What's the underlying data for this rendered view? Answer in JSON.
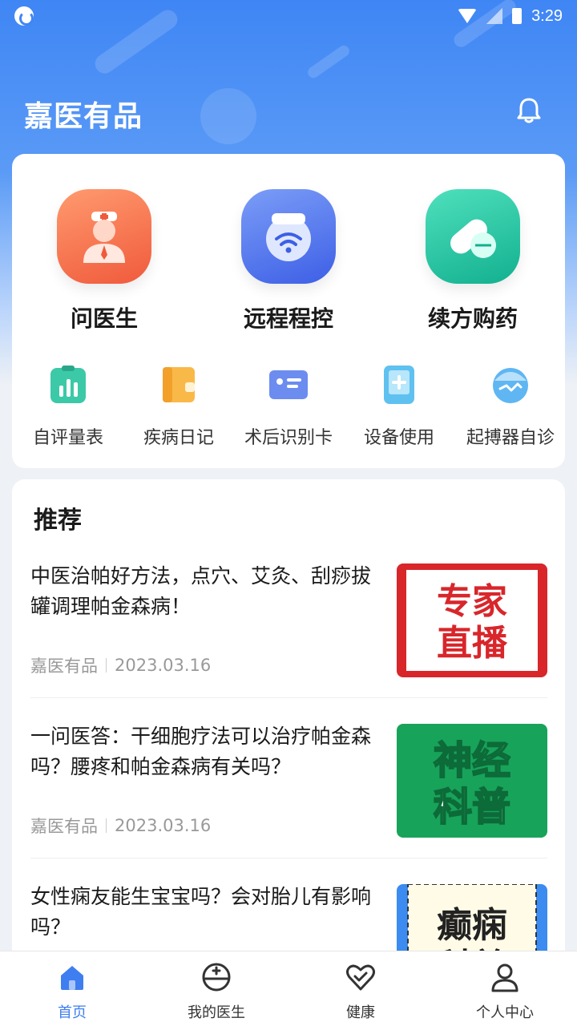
{
  "status_bar": {
    "time": "3:29"
  },
  "header": {
    "app_title": "嘉医有品"
  },
  "quick_actions": [
    {
      "label": "问医生",
      "icon": "doctor-icon",
      "color": "#f46a4a"
    },
    {
      "label": "远程程控",
      "icon": "remote-control-icon",
      "color": "#4a72f0"
    },
    {
      "label": "续方购药",
      "icon": "pill-icon",
      "color": "#22c3a6"
    }
  ],
  "tools": [
    {
      "label": "自评量表",
      "icon": "scale-chart-icon"
    },
    {
      "label": "疾病日记",
      "icon": "diary-icon"
    },
    {
      "label": "术后识别卡",
      "icon": "id-card-icon"
    },
    {
      "label": "设备使用",
      "icon": "device-icon"
    },
    {
      "label": "起搏器自诊",
      "icon": "pacemaker-icon"
    }
  ],
  "recommend": {
    "title": "推荐",
    "articles": [
      {
        "title": "中医治帕好方法，点穴、艾灸、刮痧拔罐调理帕金森病！",
        "source": "嘉医有品",
        "date": "2023.03.16",
        "thumb_text": [
          "专家",
          "直播"
        ],
        "thumb_color": "#d8262b"
      },
      {
        "title": "一问医答：干细胞疗法可以治疗帕金森吗？腰疼和帕金森病有关吗？",
        "source": "嘉医有品",
        "date": "2023.03.16",
        "thumb_text": [
          "神经",
          "科普"
        ],
        "thumb_color": "#18a35a"
      },
      {
        "title": "女性痫友能生宝宝吗？会对胎儿有影响吗？",
        "source": "",
        "date": "",
        "thumb_text": [
          "癫痫",
          "科普"
        ],
        "thumb_color": "#3b8bf0"
      }
    ]
  },
  "tabbar": [
    {
      "label": "首页",
      "icon": "home-icon",
      "active": true
    },
    {
      "label": "我的医生",
      "icon": "my-doctor-icon",
      "active": false
    },
    {
      "label": "健康",
      "icon": "health-heart-icon",
      "active": false
    },
    {
      "label": "个人中心",
      "icon": "user-icon",
      "active": false
    }
  ],
  "colors": {
    "accent": "#3f7ef0",
    "hero_top": "#3f86f5"
  }
}
